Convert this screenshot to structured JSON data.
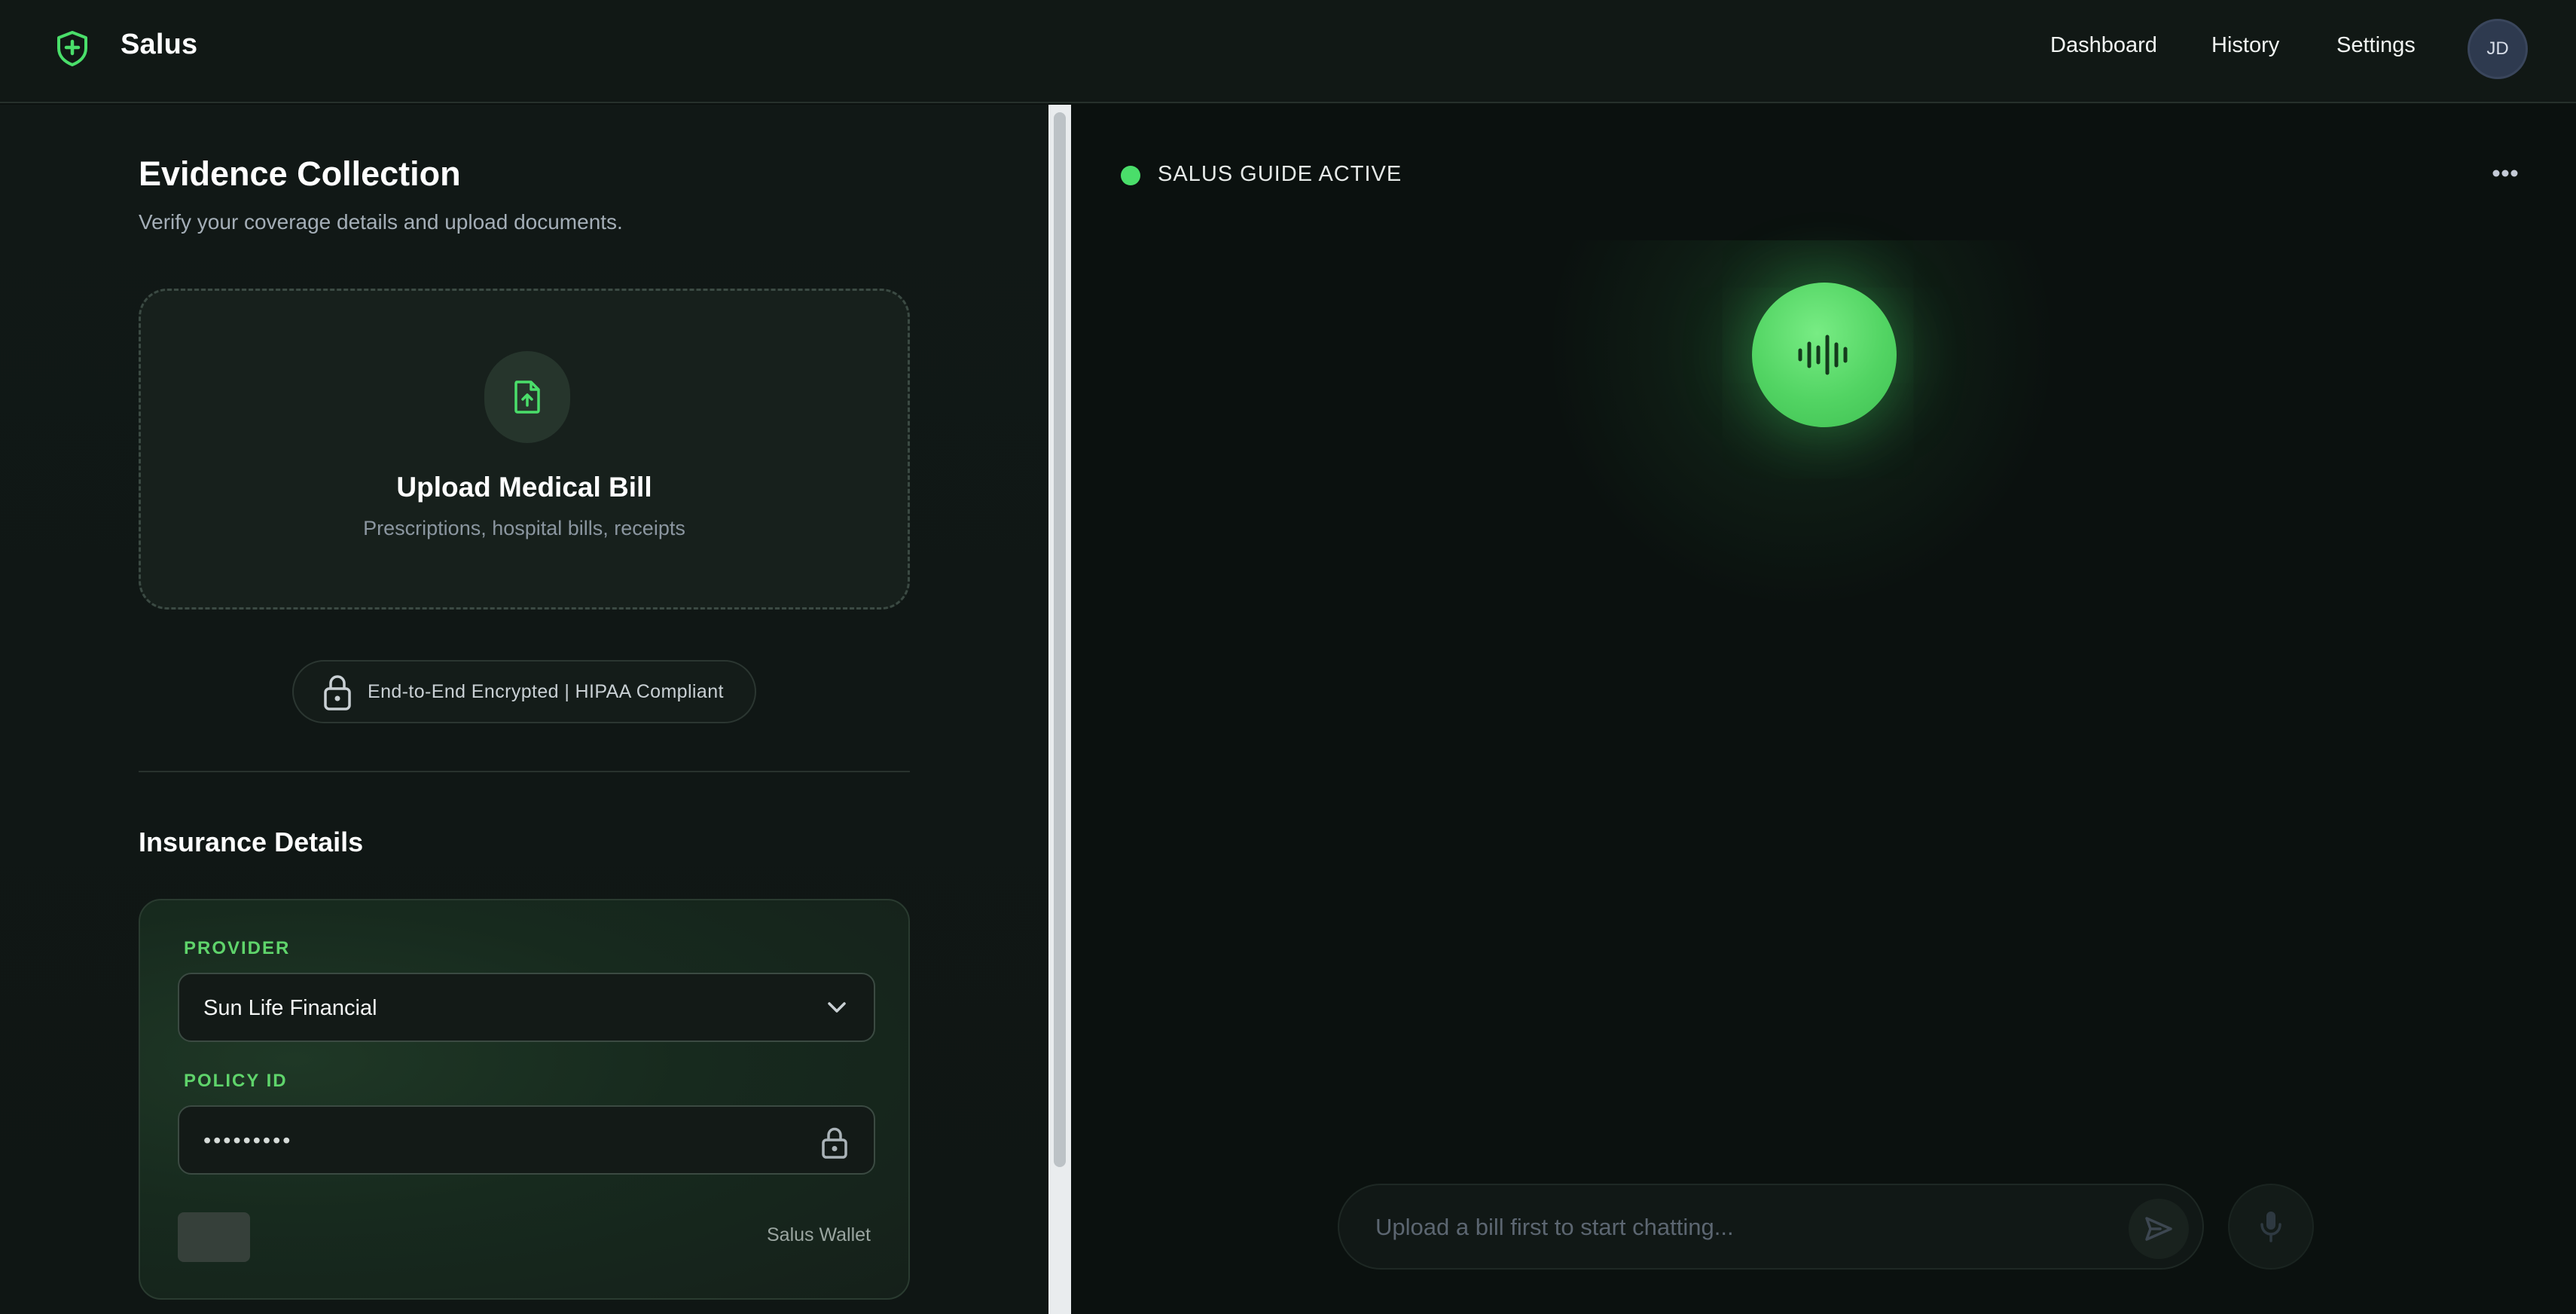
{
  "brand": {
    "name": "Salus",
    "icon": "shield-plus-icon"
  },
  "nav": {
    "links": [
      "Dashboard",
      "History",
      "Settings"
    ],
    "avatar_initials": "JD"
  },
  "evidence": {
    "title": "Evidence Collection",
    "subtitle": "Verify your coverage details and upload documents.",
    "upload": {
      "icon": "file-upload-icon",
      "title": "Upload Medical Bill",
      "subtitle": "Prescriptions, hospital bills, receipts"
    },
    "security_badge": "End-to-End Encrypted | HIPAA Compliant"
  },
  "insurance": {
    "title": "Insurance Details",
    "provider_label": "PROVIDER",
    "provider_value": "Sun Life Financial",
    "policy_label": "POLICY ID",
    "policy_value": "•••••••••",
    "wallet_label": "Salus Wallet"
  },
  "guide": {
    "status": "SALUS GUIDE ACTIVE",
    "chat_placeholder": "Upload a bill first to start chatting..."
  },
  "colors": {
    "accent": "#4ade6a",
    "background": "#0c1210",
    "label_green": "#5fd46b"
  }
}
